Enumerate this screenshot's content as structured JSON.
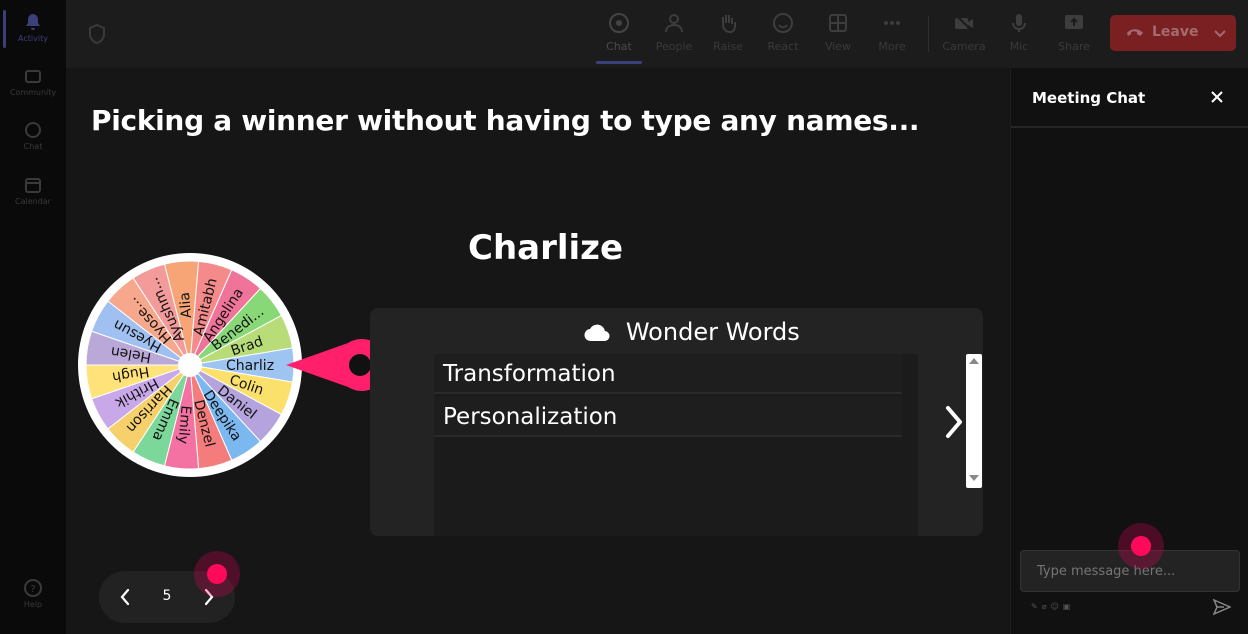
{
  "rail": {
    "items": [
      {
        "label": "Activity",
        "icon": "bell-icon"
      },
      {
        "label": "Community",
        "icon": "community-icon"
      },
      {
        "label": "Chat",
        "icon": "chat-icon"
      },
      {
        "label": "Calendar",
        "icon": "calendar-icon"
      },
      {
        "label": "Help",
        "icon": "help-icon"
      }
    ]
  },
  "toolbar": {
    "chat": "Chat",
    "people": "People",
    "raise": "Raise",
    "react": "React",
    "view": "View",
    "more": "More",
    "camera": "Camera",
    "mic": "Mic",
    "share": "Share",
    "leave": "Leave"
  },
  "slide": {
    "title": "Picking a winner without having to type any names...",
    "winner": "Charlize",
    "wheel_names": [
      "Alia",
      "Amitabh",
      "Angelina",
      "Benedi...",
      "Brad",
      "Charliz",
      "Colin",
      "Daniel",
      "Deepika",
      "Denzel",
      "Emily",
      "Emma",
      "Harrison",
      "Hrithik",
      "Hugh",
      "Helen",
      "Hyesun",
      "Hyose...",
      "Ayushm..."
    ],
    "wonder_words": {
      "title": "Wonder Words",
      "items": [
        "Transformation",
        "Personalization"
      ]
    },
    "page_number": "5"
  },
  "chat": {
    "title": "Meeting Chat",
    "input_placeholder": "Type message here..."
  },
  "colors": {
    "leave": "#7a1f22",
    "pointer": "#ff1f6b",
    "cursor": "#ff0a5a"
  }
}
